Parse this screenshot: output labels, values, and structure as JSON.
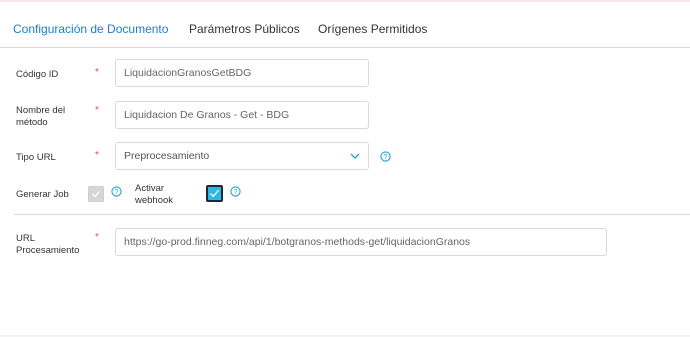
{
  "tabs": [
    {
      "label": "Configuración de Documento",
      "active": true
    },
    {
      "label": "Parámetros Públicos",
      "active": false
    },
    {
      "label": "Orígenes Permitidos",
      "active": false
    }
  ],
  "form": {
    "codigo": {
      "label": "Código ID",
      "required": "*",
      "value": "LiquidacionGranosGetBDG"
    },
    "nombre": {
      "label_line1": "Nombre del",
      "label_line2": "método",
      "required": "*",
      "value": "Liquidacion De Granos - Get - BDG"
    },
    "tipo_url": {
      "label": "Tipo URL",
      "required": "*",
      "value": "Preprocesamiento"
    },
    "generar_job": {
      "label": "Generar Job",
      "checked": false
    },
    "activar_webhook": {
      "label_line1": "Activar",
      "label_line2": "webhook",
      "checked": true
    },
    "url": {
      "label_line1": "URL",
      "label_line2": "Procesamiento",
      "required": "*",
      "value": "https://go-prod.finneg.com/api/1/botgranos-methods-get/liquidacionGranos"
    }
  },
  "colors": {
    "accent": "#1b7fc9",
    "required": "#d9534f",
    "check_on": "#2eb8e6",
    "help": "#1fa3d6"
  },
  "icons": {
    "help": "question-circle-icon",
    "chevron": "chevron-down-icon",
    "check": "checkmark-icon"
  }
}
